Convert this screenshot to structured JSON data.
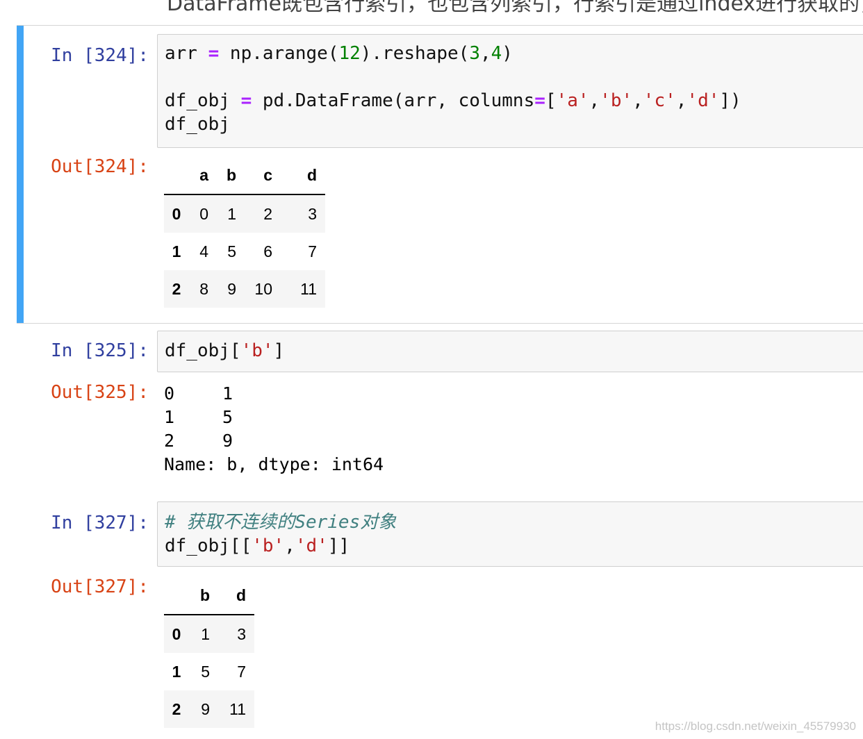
{
  "top_text": "DataFrame既包含行索引，也包含列索引，行索引是通过index进行获取的，列索引",
  "cells": [
    {
      "in_prompt": "In [324]:",
      "code_lines": [
        [
          {
            "t": "arr ",
            "c": ""
          },
          {
            "t": "=",
            "c": "op"
          },
          {
            "t": " np.arange(",
            "c": ""
          },
          {
            "t": "12",
            "c": "num"
          },
          {
            "t": ").reshape(",
            "c": ""
          },
          {
            "t": "3",
            "c": "num"
          },
          {
            "t": ",",
            "c": ""
          },
          {
            "t": "4",
            "c": "num"
          },
          {
            "t": ")",
            "c": ""
          }
        ],
        [],
        [
          {
            "t": "df_obj ",
            "c": ""
          },
          {
            "t": "=",
            "c": "op"
          },
          {
            "t": " pd.DataFrame(arr, columns",
            "c": ""
          },
          {
            "t": "=",
            "c": "op"
          },
          {
            "t": "[",
            "c": ""
          },
          {
            "t": "'a'",
            "c": "str"
          },
          {
            "t": ",",
            "c": ""
          },
          {
            "t": "'b'",
            "c": "str"
          },
          {
            "t": ",",
            "c": ""
          },
          {
            "t": "'c'",
            "c": "str"
          },
          {
            "t": ",",
            "c": ""
          },
          {
            "t": "'d'",
            "c": "str"
          },
          {
            "t": "])",
            "c": ""
          }
        ],
        [
          {
            "t": "df_obj",
            "c": ""
          }
        ]
      ],
      "out_prompt": "Out[324]:",
      "table": {
        "columns": [
          "",
          "a",
          "b",
          "c",
          "d"
        ],
        "rows": [
          [
            "0",
            "0",
            "1",
            "2",
            "3"
          ],
          [
            "1",
            "4",
            "5",
            "6",
            "7"
          ],
          [
            "2",
            "8",
            "9",
            "10",
            "11"
          ]
        ]
      }
    },
    {
      "in_prompt": "In [325]:",
      "code_lines": [
        [
          {
            "t": "df_obj[",
            "c": ""
          },
          {
            "t": "'b'",
            "c": "str"
          },
          {
            "t": "]",
            "c": ""
          }
        ]
      ],
      "out_prompt": "Out[325]:",
      "series": {
        "rows": [
          [
            "0",
            "1"
          ],
          [
            "1",
            "5"
          ],
          [
            "2",
            "9"
          ]
        ],
        "footer": "Name: b, dtype: int64"
      }
    },
    {
      "in_prompt": "In [327]:",
      "code_lines": [
        [
          {
            "t": "# 获取不连续的Series对象",
            "c": "cmt"
          }
        ],
        [
          {
            "t": "df_obj[[",
            "c": ""
          },
          {
            "t": "'b'",
            "c": "str"
          },
          {
            "t": ",",
            "c": ""
          },
          {
            "t": "'d'",
            "c": "str"
          },
          {
            "t": "]]",
            "c": ""
          }
        ]
      ],
      "out_prompt": "Out[327]:",
      "table": {
        "columns": [
          "",
          "b",
          "d"
        ],
        "rows": [
          [
            "0",
            "1",
            "3"
          ],
          [
            "1",
            "5",
            "7"
          ],
          [
            "2",
            "9",
            "11"
          ]
        ]
      }
    }
  ],
  "watermark": "https://blog.csdn.net/weixin_45579930"
}
